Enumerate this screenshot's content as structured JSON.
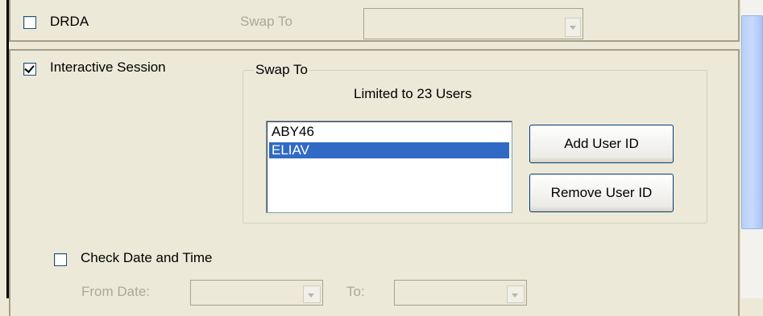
{
  "drda": {
    "checkbox_label": "DRDA",
    "checked": false,
    "swap_to_label": "Swap To",
    "swap_to_value": ""
  },
  "interactive": {
    "checkbox_label": "Interactive Session",
    "checked": true
  },
  "swap_group": {
    "title": "Swap To",
    "limit_text": "Limited to 23 Users",
    "users": [
      "ABY46",
      "ELIAV"
    ],
    "selected_user": "ELIAV",
    "add_button": "Add User ID",
    "remove_button": "Remove User ID"
  },
  "date_time": {
    "checkbox_label": "Check Date and Time",
    "checked": false,
    "from_label": "From Date:",
    "from_value": "",
    "to_label": "To:",
    "to_value": ""
  },
  "colors": {
    "selection": "#316ac5",
    "window_bg": "#ece9d8",
    "scroll_thumb": "#c8dafc"
  }
}
